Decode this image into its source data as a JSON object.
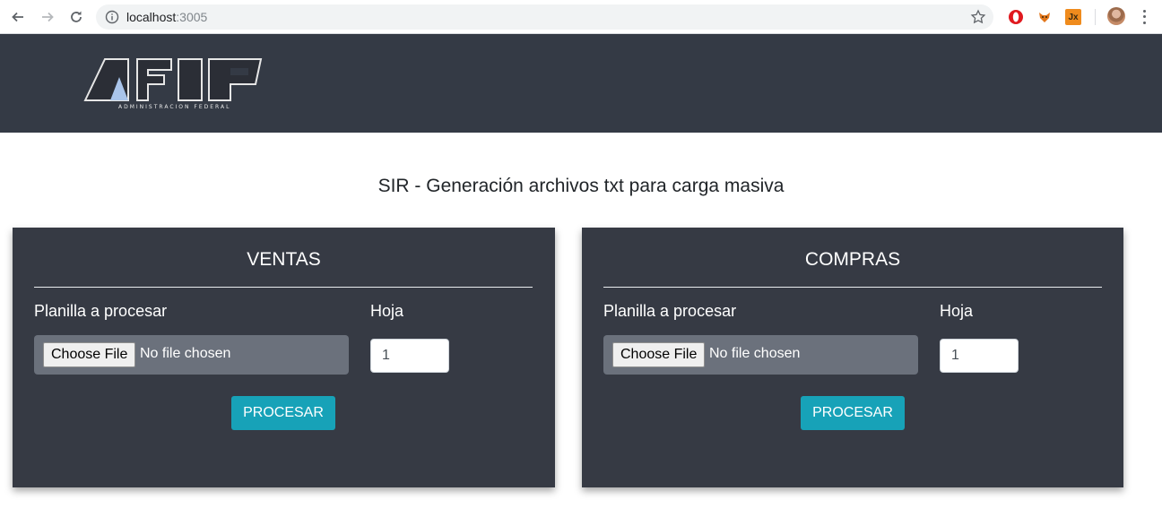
{
  "browser": {
    "url_host": "localhost",
    "url_port": ":3005"
  },
  "header": {
    "logo_text": "AFIP",
    "logo_subtitle": "ADMINISTRACION FEDERAL"
  },
  "page": {
    "title": "SIR - Generación archivos txt para carga masiva"
  },
  "cards": [
    {
      "title": "VENTAS",
      "file_label": "Planilla a procesar",
      "file_button": "Choose File",
      "file_status": "No file chosen",
      "sheet_label": "Hoja",
      "sheet_value": "1",
      "submit_label": "PROCESAR"
    },
    {
      "title": "COMPRAS",
      "file_label": "Planilla a procesar",
      "file_button": "Choose File",
      "file_status": "No file chosen",
      "sheet_label": "Hoja",
      "sheet_value": "1",
      "submit_label": "PROCESAR"
    }
  ],
  "colors": {
    "header_bg": "#343a45",
    "card_bg": "#363a44",
    "file_box_bg": "#6b717c",
    "accent": "#17a2b8"
  },
  "icons": {
    "back": "arrow-left-icon",
    "forward": "arrow-right-icon",
    "reload": "reload-icon",
    "info": "info-icon",
    "bookmark": "star-icon",
    "ext1": "opera-icon",
    "ext2": "fox-icon",
    "ext3": "jx-icon",
    "profile": "avatar",
    "menu": "kebab-menu-icon"
  }
}
